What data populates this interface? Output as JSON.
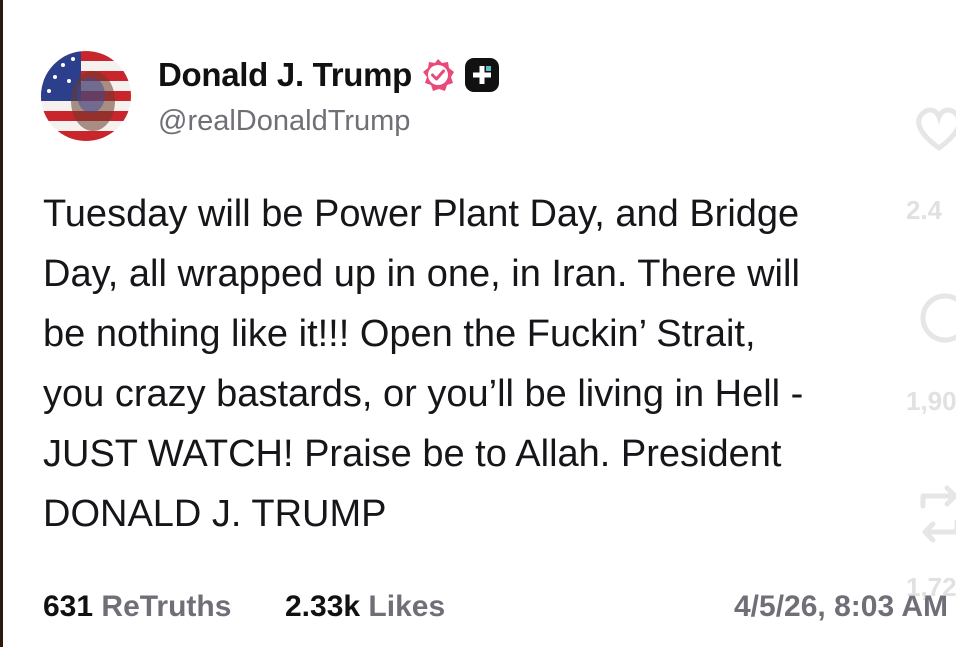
{
  "post": {
    "display_name": "Donald J. Trump",
    "handle": "@realDonaldTrump",
    "verified_icon": "verified-badge-icon",
    "platform_icon": "truth-social-icon",
    "text": "Tuesday will be Power Plant Day, and Bridge\nDay, all wrapped up in one, in Iran. There will\nbe nothing like it!!! Open the Fuckin’ Strait,\nyou crazy bastards, or you’ll be living in Hell -\nJUST WATCH! Praise be to Allah. President\nDONALD J. TRUMP",
    "retruths_count": "631",
    "retruths_label": "ReTruths",
    "likes_count": "2.33k",
    "likes_label": "Likes",
    "timestamp": "4/5/26, 8:03 AM"
  },
  "overlay": {
    "count_1": "2.4",
    "count_2": "1,90",
    "count_3": "1,72",
    "icons": [
      "heart-icon",
      "comment-icon",
      "share-icon"
    ]
  },
  "colors": {
    "accent_verified": "#e84a7a",
    "text_primary": "#111111",
    "text_secondary": "#6f6f78"
  }
}
